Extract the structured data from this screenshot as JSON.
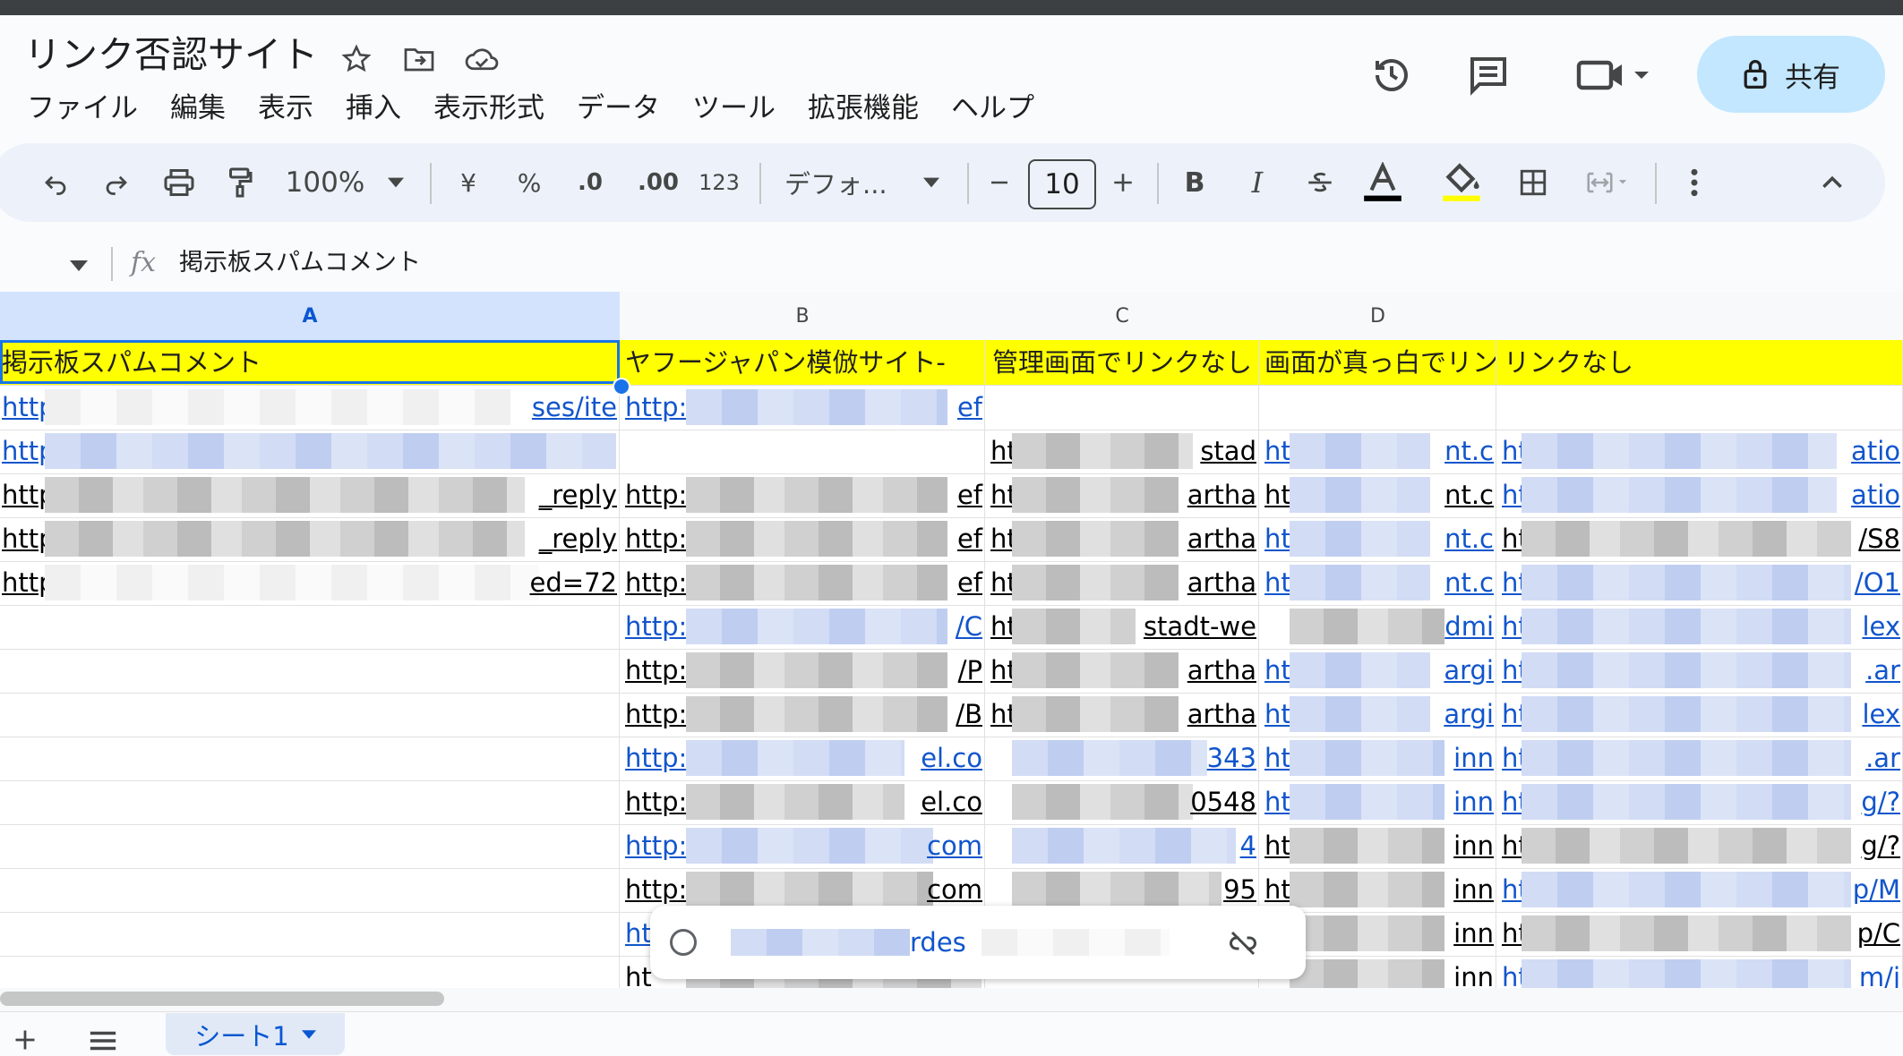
{
  "title": "リンク否認サイト",
  "menu": [
    "ファイル",
    "編集",
    "表示",
    "挿入",
    "表示形式",
    "データ",
    "ツール",
    "拡張機能",
    "ヘルプ"
  ],
  "share_label": "共有",
  "toolbar": {
    "zoom": "100%",
    "currency": "¥",
    "percent": "%",
    "dec_decrease": ".0",
    "dec_increase": ".00",
    "format_123": "123",
    "font": "デフォ...",
    "font_size": "10",
    "bold": "B",
    "italic": "I"
  },
  "formula": {
    "value": "掲示板スパムコメント"
  },
  "columns": [
    "A",
    "B",
    "C",
    "D"
  ],
  "header_row": {
    "a": "掲示板スパムコメント",
    "b": "ヤフージャパン模倣サイト-",
    "c": "管理画面でリンクなし",
    "d": "画面が真っ白でリンク",
    "e": "リンクなし"
  },
  "rows": [
    {
      "a1": "http:/",
      "a2": "ses/ite",
      "b1": "http:/",
      "b2": "ef",
      "c1": "",
      "c2": "",
      "d1": "",
      "d2": "",
      "e1": "",
      "e2": ""
    },
    {
      "a1": "http:/",
      "a2": "",
      "b1": "",
      "b2": "",
      "c1": "ht",
      "c2": "stad",
      "d1": "http",
      "d2": "nt.c",
      "e1": "ht",
      "e2": "atio"
    },
    {
      "a1": "http:/",
      "a2": "_reply",
      "b1": "http:/",
      "b2": "ef",
      "c1": "ht",
      "c2": "artha",
      "d1": "http",
      "d2": "nt.c",
      "e1": "ht",
      "e2": "atio"
    },
    {
      "a1": "http:/",
      "a2": "_reply",
      "b1": "http:/",
      "b2": "ef",
      "c1": "ht",
      "c2": "artha",
      "d1": "http",
      "d2": "nt.c",
      "e1": "ht",
      "e2": "/S8"
    },
    {
      "a1": "http:/",
      "a2": "ed=72",
      "b1": "http:/",
      "b2": "ef",
      "c1": "ht",
      "c2": "artha",
      "d1": "http",
      "d2": "nt.c",
      "e1": "ht",
      "e2": "/O1"
    },
    {
      "a1": "",
      "a2": "",
      "b1": "http:/",
      "b2": "/C",
      "c1": "ht",
      "c2": "stadt-we",
      "d1": "",
      "d2": "dmi",
      "e1": "ht",
      "e2": "lex"
    },
    {
      "a1": "",
      "a2": "",
      "b1": "http:/",
      "b2": "/P",
      "c1": "ht",
      "c2": "artha",
      "d1": "http",
      "d2": "argi",
      "e1": "ht",
      "e2": ".ar"
    },
    {
      "a1": "",
      "a2": "",
      "b1": "http:/",
      "b2": "/B",
      "c1": "ht",
      "c2": "artha",
      "d1": "http",
      "d2": "argi",
      "e1": "ht",
      "e2": "lex"
    },
    {
      "a1": "",
      "a2": "",
      "b1": "http:/",
      "b2": "el.co",
      "c1": "",
      "c2": "343",
      "d1": "http",
      "d2": "inn",
      "e1": "ht",
      "e2": ".ar"
    },
    {
      "a1": "",
      "a2": "",
      "b1": "http:/",
      "b2": "el.co",
      "c1": "",
      "c2": "0548",
      "d1": "http",
      "d2": "inn",
      "e1": "ht",
      "e2": "g/?"
    },
    {
      "a1": "",
      "a2": "",
      "b1": "http:/",
      "b2": "com",
      "c1": "",
      "c2": "4",
      "d1": "http",
      "d2": "inn",
      "e1": "ht",
      "e2": "g/?"
    },
    {
      "a1": "",
      "a2": "",
      "b1": "http:/",
      "b2": "com",
      "c1": "",
      "c2": "95",
      "d1": "http",
      "d2": "inn",
      "e1": "ht",
      "e2": "p/M"
    },
    {
      "a1": "",
      "a2": "",
      "b1": "ht",
      "b2": "",
      "c1": "",
      "c2": "",
      "d1": "",
      "d2": "inn",
      "e1": "ht",
      "e2": "p/C"
    },
    {
      "a1": "",
      "a2": "",
      "b1": "ht",
      "b2": "",
      "c1": "",
      "c2": "",
      "d1": "",
      "d2": "inn",
      "e1": "ht",
      "e2": "m/j"
    }
  ],
  "link_chip": {
    "text": "rdes"
  },
  "sheet_tab": "シート1",
  "colors": {
    "accent": "#0b57d0",
    "highlight": "#ffff00",
    "share_bg": "#c2e7ff",
    "link": "#1155cc"
  }
}
